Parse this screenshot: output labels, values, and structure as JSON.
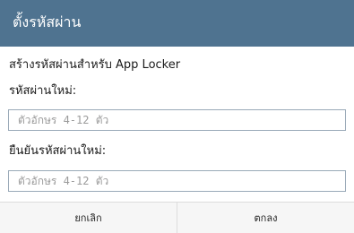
{
  "dialog": {
    "title": "ตั้งรหัสผ่าน",
    "subtitle": "สร้างรหัสผ่านสำหรับ App Locker",
    "new_password": {
      "label": "รหัสผ่านใหม่:",
      "placeholder": "ตัวอักษร 4-12 ตัว",
      "value": ""
    },
    "confirm_password": {
      "label": "ยืนยันรหัสผ่านใหม่:",
      "placeholder": "ตัวอักษร 4-12 ตัว",
      "value": ""
    },
    "buttons": {
      "cancel": "ยกเลิก",
      "ok": "ตกลง"
    }
  },
  "colors": {
    "titlebar": "#4f7390",
    "field_border": "#9aaab8"
  }
}
